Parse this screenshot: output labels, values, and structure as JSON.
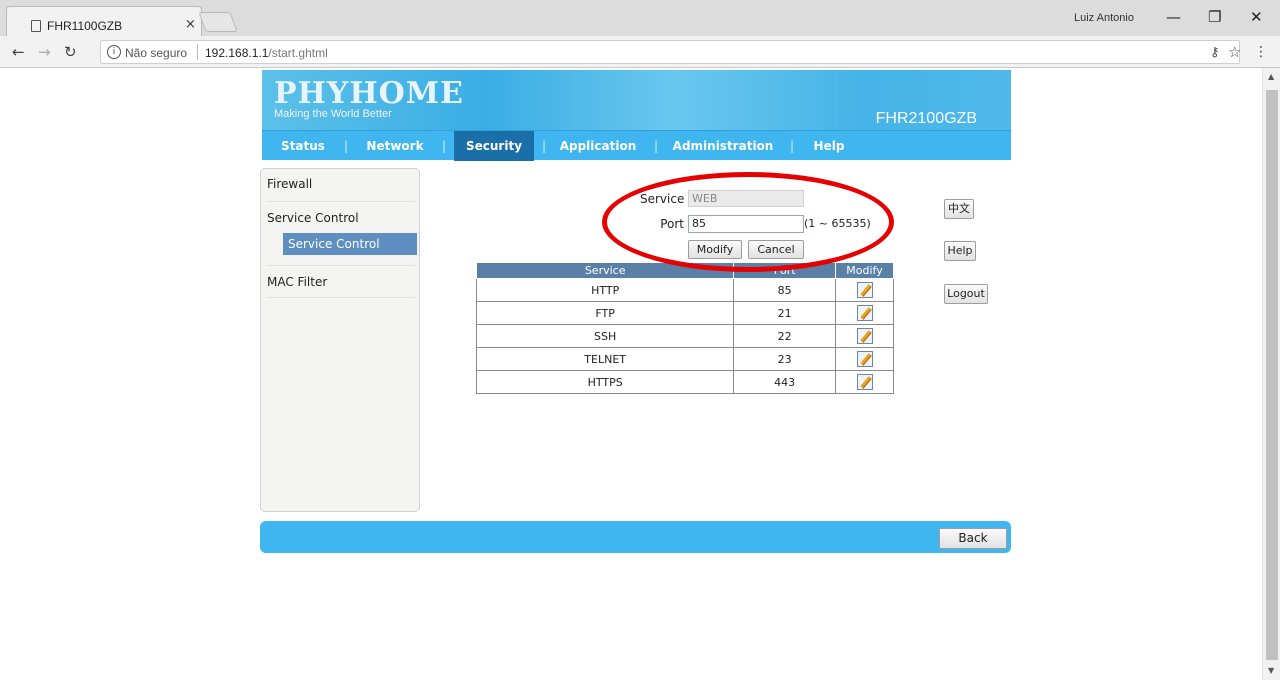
{
  "browser": {
    "tab_title": "FHR1100GZB",
    "tab_close": "×",
    "user": "Luiz Antonio",
    "security_label": "Não seguro",
    "url_host": "192.168.1.1",
    "url_path": "/start.ghtml"
  },
  "banner": {
    "logo": "PHYHOME",
    "tagline": "Making the World Better",
    "model": "FHR2100GZB"
  },
  "menu": {
    "items": [
      "Status",
      "Network",
      "Security",
      "Application",
      "Administration",
      "Help"
    ],
    "active": "Security"
  },
  "sidebar": {
    "items": [
      "Firewall",
      "Service Control",
      "MAC Filter"
    ],
    "sub_item": "Service Control"
  },
  "form": {
    "service_label": "Service",
    "service_value": "WEB",
    "port_label": "Port",
    "port_value": "85",
    "port_range": "(1 ~ 65535)",
    "modify_button": "Modify",
    "cancel_button": "Cancel"
  },
  "table": {
    "headers": [
      "Service",
      "Port",
      "Modify"
    ],
    "rows": [
      {
        "service": "HTTP",
        "port": "85"
      },
      {
        "service": "FTP",
        "port": "21"
      },
      {
        "service": "SSH",
        "port": "22"
      },
      {
        "service": "TELNET",
        "port": "23"
      },
      {
        "service": "HTTPS",
        "port": "443"
      }
    ]
  },
  "side_buttons": {
    "chinese": "中文",
    "help": "Help",
    "logout": "Logout"
  },
  "footer": {
    "back_button": "Back"
  },
  "colors": {
    "banner_blue": "#3fb6f0",
    "active_menu": "#1b6fa8",
    "table_header": "#5b80a8",
    "highlight_ellipse": "#e60000"
  }
}
